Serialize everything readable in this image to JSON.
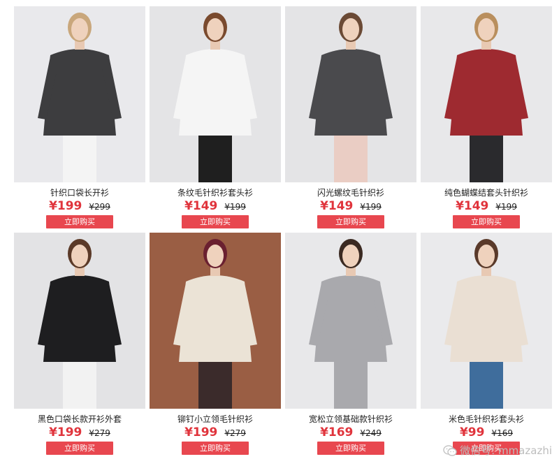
{
  "products": [
    {
      "name": "针织口袋长开衫",
      "price": "¥199",
      "old_price": "¥299",
      "button": "立即购买",
      "photo": {
        "bg": "#e9e9ec",
        "garment": "#3d3d3f",
        "inner": "#f4f4f4",
        "hair": "#c9a77c"
      }
    },
    {
      "name": "条纹毛针织衫套头衫",
      "price": "¥149",
      "old_price": "¥199",
      "button": "立即购买",
      "photo": {
        "bg": "#e4e4e6",
        "garment": "#f5f5f5",
        "inner": "#1f1f1f",
        "hair": "#7a4a2e"
      }
    },
    {
      "name": "闪光螺纹毛针织衫",
      "price": "¥149",
      "old_price": "¥199",
      "button": "立即购买",
      "photo": {
        "bg": "#e4e4e6",
        "garment": "#4a4a4d",
        "inner": "#eacdc4",
        "hair": "#6b4a35"
      }
    },
    {
      "name": "纯色蝴蝶结套头针织衫",
      "price": "¥149",
      "old_price": "¥199",
      "button": "立即购买",
      "photo": {
        "bg": "#e8e8ea",
        "garment": "#9e2a30",
        "inner": "#2a2a2d",
        "hair": "#b98f5e"
      }
    },
    {
      "name": "黑色口袋长款开衫外套",
      "price": "¥199",
      "old_price": "¥279",
      "button": "立即购买",
      "photo": {
        "bg": "#e3e3e5",
        "garment": "#1e1e20",
        "inner": "#f2f2f2",
        "hair": "#5b3a28"
      }
    },
    {
      "name": "铆钉小立领毛针织衫",
      "price": "¥199",
      "old_price": "¥279",
      "button": "立即购买",
      "photo": {
        "bg": "#9a5e44",
        "garment": "#ebe3d6",
        "inner": "#3b2b2b",
        "hair": "#6a2030"
      }
    },
    {
      "name": "宽松立领基础款针织衫",
      "price": "¥169",
      "old_price": "¥249",
      "button": "立即购买",
      "photo": {
        "bg": "#e8e8ea",
        "garment": "#a9a9ad",
        "inner": "#a9a9ad",
        "hair": "#3b2a22"
      }
    },
    {
      "name": "米色毛针织衫套头衫",
      "price": "¥99",
      "old_price": "¥169",
      "button": "立即购买",
      "photo": {
        "bg": "#eaeaec",
        "garment": "#eadfd3",
        "inner": "#3f6d9c",
        "hair": "#5a3a2a"
      }
    }
  ],
  "watermark": {
    "text": "微信号: mmazazhi",
    "icon": "wechat-icon"
  }
}
